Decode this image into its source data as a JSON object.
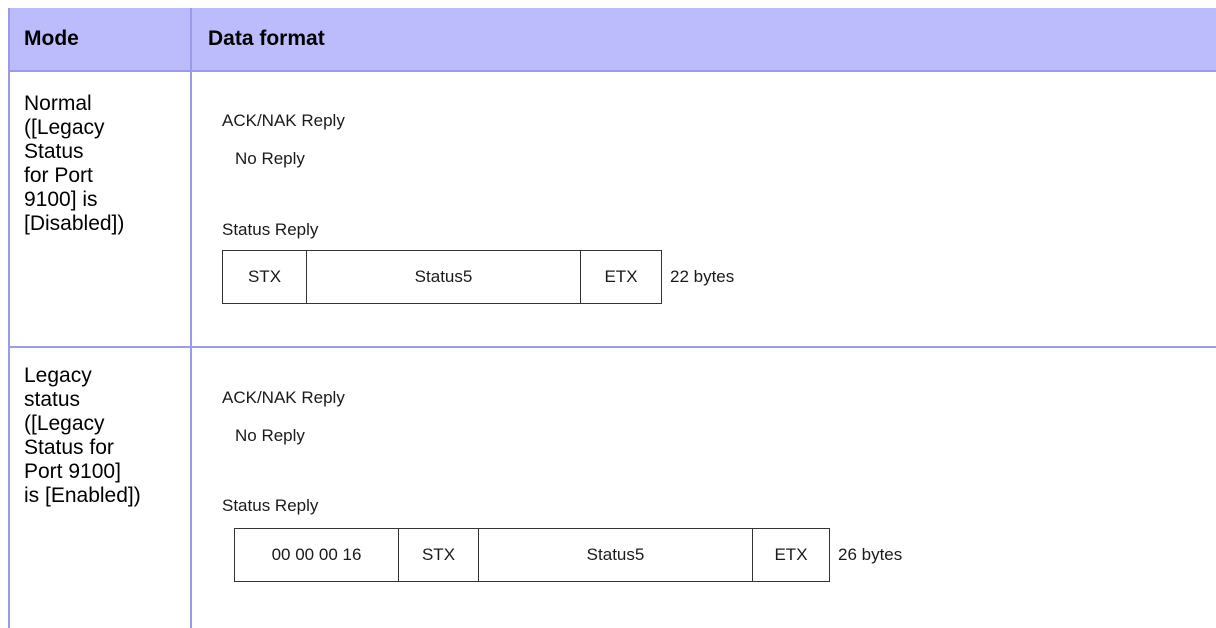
{
  "table": {
    "header": {
      "mode": "Mode",
      "data_format": "Data format"
    },
    "rows": [
      {
        "mode_lines": [
          "Normal",
          "([Legacy",
          "Status",
          "for Port",
          "9100] is",
          "[Disabled])"
        ],
        "ack_label": "ACK/NAK Reply",
        "ack_value": "No Reply",
        "status_label": "Status Reply",
        "frame": [
          "STX",
          "Status5",
          "ETX"
        ],
        "bytes": "22 bytes"
      },
      {
        "mode_lines": [
          "Legacy",
          "status",
          "([Legacy",
          "Status for",
          "Port 9100]",
          "is [Enabled])"
        ],
        "ack_label": "ACK/NAK Reply",
        "ack_value": "No Reply",
        "status_label": "Status Reply",
        "frame": [
          "00 00 00 16",
          "STX",
          "Status5",
          "ETX"
        ],
        "bytes": "26 bytes"
      }
    ]
  }
}
